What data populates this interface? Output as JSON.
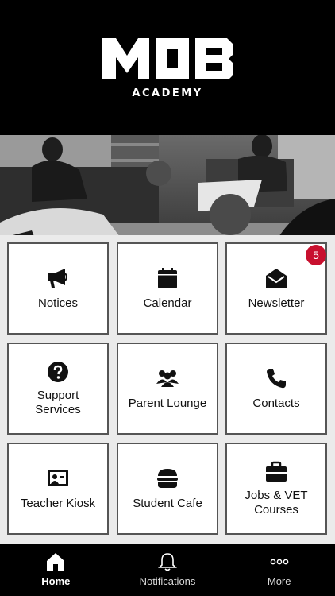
{
  "header": {
    "logo_text": "MOB",
    "logo_subtitle": "ACADEMY"
  },
  "hero": {
    "image": "students-lounge-photo-bw"
  },
  "tiles": [
    {
      "label": "Notices",
      "icon": "megaphone-icon"
    },
    {
      "label": "Calendar",
      "icon": "calendar-icon"
    },
    {
      "label": "Newsletter",
      "icon": "envelope-open-icon",
      "badge": "5"
    },
    {
      "label": "Support\nServices",
      "icon": "question-circle-icon"
    },
    {
      "label": "Parent Lounge",
      "icon": "users-group-icon"
    },
    {
      "label": "Contacts",
      "icon": "phone-icon"
    },
    {
      "label": "Teacher Kiosk",
      "icon": "presentation-icon"
    },
    {
      "label": "Student Cafe",
      "icon": "burger-icon"
    },
    {
      "label": "Jobs & VET\nCourses",
      "icon": "briefcase-icon"
    }
  ],
  "tabbar": {
    "home": "Home",
    "notifications": "Notifications",
    "more": "More"
  },
  "colors": {
    "badge": "#c8102e",
    "header": "#000000",
    "tile_border": "#555555"
  }
}
